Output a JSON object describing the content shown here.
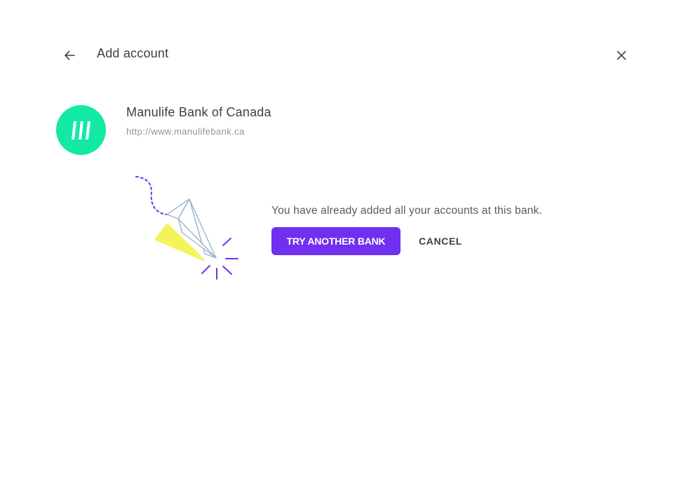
{
  "header": {
    "back_icon": "arrow-left-icon",
    "title": "Add account",
    "close_icon": "close-icon"
  },
  "bank": {
    "logo_icon": "manulife-logo-icon",
    "logo_color": "#13e9a5",
    "name": "Manulife Bank of Canada",
    "url": "http://www.manulifebank.ca"
  },
  "illustration": {
    "icon": "paper-plane-illustration"
  },
  "message": {
    "text": "You have already added all your accounts at this bank."
  },
  "actions": {
    "primary_label": "TRY ANOTHER BANK",
    "primary_color": "#7130f0",
    "secondary_label": "CANCEL"
  }
}
